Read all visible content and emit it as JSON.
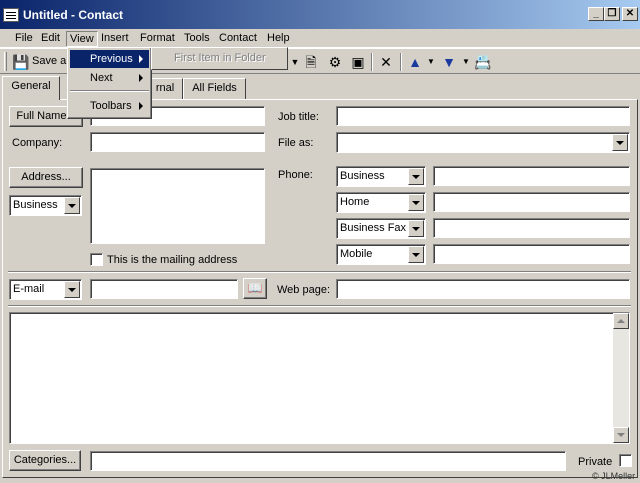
{
  "window": {
    "title": "Untitled - Contact",
    "minimize": "_",
    "restore": "❐",
    "close": "✕"
  },
  "menubar": [
    "File",
    "Edit",
    "View",
    "Insert",
    "Format",
    "Tools",
    "Contact",
    "Help"
  ],
  "toolbar": {
    "save_label": "Save a"
  },
  "view_menu": {
    "items": [
      {
        "label": "Previous",
        "highlighted": true,
        "submenu": true
      },
      {
        "label": "Next",
        "highlighted": false,
        "submenu": true
      },
      {
        "label": "Toolbars",
        "highlighted": false,
        "submenu": true
      }
    ],
    "submenu_item": "First Item in Folder"
  },
  "tabs": [
    "General",
    "rnal",
    "All Fields"
  ],
  "form": {
    "full_name_button": "Full Name...",
    "company_label": "Company:",
    "job_title_label": "Job title:",
    "file_as_label": "File as:",
    "address_button": "Address...",
    "address_type": "Business",
    "mailing_checkbox_label": "This is the mailing address",
    "phone_label": "Phone:",
    "phones": [
      "Business",
      "Home",
      "Business Fax",
      "Mobile"
    ],
    "email_type": "E-mail",
    "web_page_label": "Web page:",
    "categories_button": "Categories...",
    "private_label": "Private",
    "watermark": "© JLMeller"
  },
  "colors": {
    "titlebar_start": "#0a246a",
    "titlebar_end": "#a6caf0",
    "menu_highlight": "#0a246a",
    "face": "#d4d0c8"
  }
}
